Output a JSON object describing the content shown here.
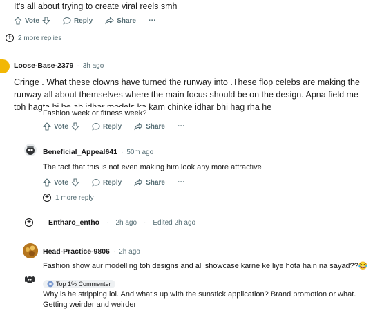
{
  "comments": {
    "top": {
      "body": "It's all about trying to create viral reels smh",
      "vote_label": "Vote",
      "reply_label": "Reply",
      "share_label": "Share",
      "more_label": "···",
      "more_replies": "2 more replies"
    },
    "loose": {
      "username": "Loose-Base-2379",
      "time": "3h ago",
      "body": "Cringe . What these clowns have turned the runway into .These flop celebs are making the runway all about themselves where the main focus should be on the design. Apna field me toh hagta hi he ab idhar models ka kam chinke idhar bhi hag rha he",
      "body2": "Fashion week or fitness week?",
      "vote_label": "Vote",
      "reply_label": "Reply",
      "share_label": "Share",
      "more_label": "···"
    },
    "beneficial": {
      "username": "Beneficial_Appeal641",
      "time": "50m ago",
      "body": "The fact that this is not even making him look any more attractive",
      "vote_label": "Vote",
      "reply_label": "Reply",
      "share_label": "Share",
      "more_label": "···",
      "more_replies": "1 more reply"
    },
    "entharo": {
      "username": "Entharo_entho",
      "time": "2h ago",
      "edited": "Edited 2h ago"
    },
    "head": {
      "username": "Head-Practice-9806",
      "time": "2h ago",
      "body": "Fashion show aur modelling toh designs and all showcase karne ke liye hota hain na sayad??😂"
    },
    "topcommenter": {
      "badge": "Top 1% Commenter",
      "body": "Why is he stripping lol. And what's up with the sunstick application? Brand promotion or what. Getting weirder and weirder"
    }
  },
  "colors": {
    "meta": "#576f76",
    "text": "#1c1c1c",
    "line": "#e0e3e5"
  }
}
